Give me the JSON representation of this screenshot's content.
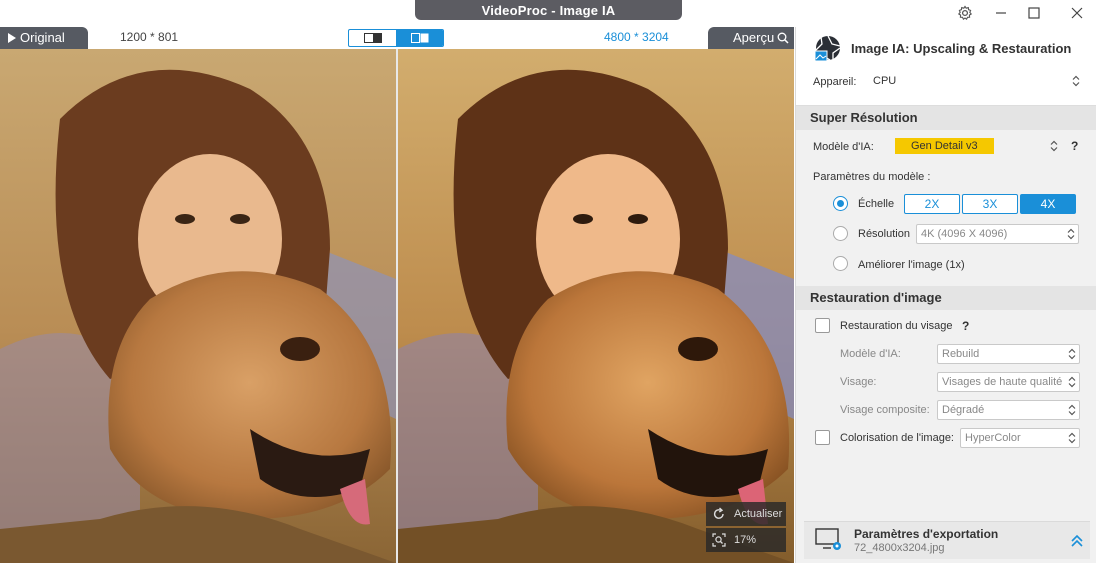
{
  "window": {
    "title": "VideoProc -  Image IA",
    "settings_icon": "gear-icon",
    "minimize_icon": "minimize-icon",
    "maximize_icon": "maximize-icon",
    "close_icon": "close-icon"
  },
  "compare": {
    "original_label": "Original",
    "original_resolution": "1200 * 801",
    "output_resolution": "4800 * 3204",
    "preview_label": "Aperçu",
    "view_mode": "split"
  },
  "overlay": {
    "refresh_label": "Actualiser",
    "zoom_label": "17%"
  },
  "panel": {
    "title": "Image IA: Upscaling & Restauration",
    "device_label": "Appareil:",
    "device_value": "CPU",
    "super_res": {
      "heading": "Super Résolution",
      "model_label": "Modèle d'IA:",
      "model_value": "Gen Detail v3",
      "model_highlight": "#f5c800",
      "help": "?",
      "params_label": "Paramètres du modèle :",
      "scale_label": "Échelle",
      "scale_options": [
        "2X",
        "3X",
        "4X"
      ],
      "scale_selected": "4X",
      "resolution_label": "Résolution",
      "resolution_value": "4K (4096 X 4096)",
      "enhance_label": "Améliorer l'image (1x)"
    },
    "restoration": {
      "heading": "Restauration d'image",
      "face_label": "Restauration du visage",
      "help": "?",
      "model_label": "Modèle d'IA:",
      "model_value": "Rebuild",
      "face_type_label": "Visage:",
      "face_type_value": "Visages de haute qualité",
      "composite_label": "Visage composite:",
      "composite_value": "Dégradé",
      "colorize_label": "Colorisation de l'image:",
      "colorize_value": "HyperColor"
    },
    "export": {
      "title": "Paramètres d'exportation",
      "filename": "72_4800x3204.jpg"
    }
  },
  "colors": {
    "accent": "#1a8fd8",
    "tab_dark": "#565a62",
    "panel_bg": "#f1f1f1"
  }
}
